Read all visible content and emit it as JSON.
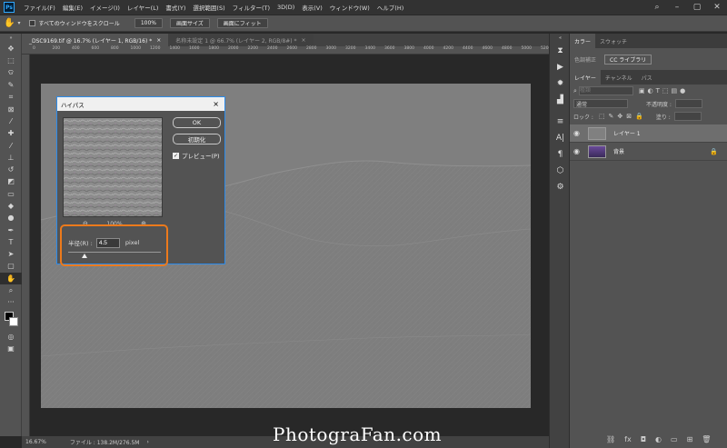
{
  "app": {
    "logo": "Ps"
  },
  "menu": [
    "ファイル(F)",
    "編集(E)",
    "イメージ(I)",
    "レイヤー(L)",
    "書式(Y)",
    "選択範囲(S)",
    "フィルター(T)",
    "3D(D)",
    "表示(V)",
    "ウィンドウ(W)",
    "ヘルプ(H)"
  ],
  "options": {
    "scroll_all": "すべてのウィンドウをスクロール",
    "zoom": "100%",
    "fit_screen": "画面サイズ",
    "fill_screen": "画面にフィット"
  },
  "tabs": [
    {
      "label": "_DSC9169.tif @ 16.7% (レイヤー 1, RGB/16) *",
      "close": "×"
    },
    {
      "label": "名称未設定 1 @ 66.7% (レイヤー 2, RGB/8#) *",
      "close": "×"
    }
  ],
  "ruler_ticks": [
    "0",
    "200",
    "400",
    "600",
    "800",
    "1000",
    "1200",
    "1400",
    "1600",
    "1800",
    "2000",
    "2200",
    "2400",
    "2600",
    "2800",
    "3000",
    "3200",
    "3400",
    "3600",
    "3800",
    "4000",
    "4200",
    "4400",
    "4600",
    "4800",
    "5000",
    "5200"
  ],
  "status": {
    "zoom": "16.67%",
    "file": "ファイル : 138.2M/276.5M"
  },
  "watermark": "PhotograFan.com",
  "panels": {
    "top_tabs": [
      "カラー",
      "スウォッチ"
    ],
    "mid_tabs": [
      "色調補正",
      "CC ライブラリ"
    ],
    "layer_tabs": [
      "レイヤー",
      "チャンネル",
      "パス"
    ],
    "search_placeholder": "種類",
    "blend_mode": "通常",
    "opacity_label": "不透明度 :",
    "lock_label": "ロック :",
    "fill_label": "塗り :",
    "layers": [
      {
        "name": "レイヤー 1",
        "selected": true
      },
      {
        "name": "背景",
        "selected": false
      }
    ]
  },
  "dialog": {
    "title": "ハイパス",
    "close": "×",
    "ok": "OK",
    "reset": "初期化",
    "preview_label": "プレビュー(P)",
    "preview_checked": true,
    "zoom_level": "100%",
    "radius_label": "半径(R) :",
    "radius_value": "4.5",
    "radius_unit": "pixel",
    "slider_level": 0.18
  },
  "colors": {
    "accent": "#2d8ceb",
    "highlight": "#ec7a1c"
  }
}
